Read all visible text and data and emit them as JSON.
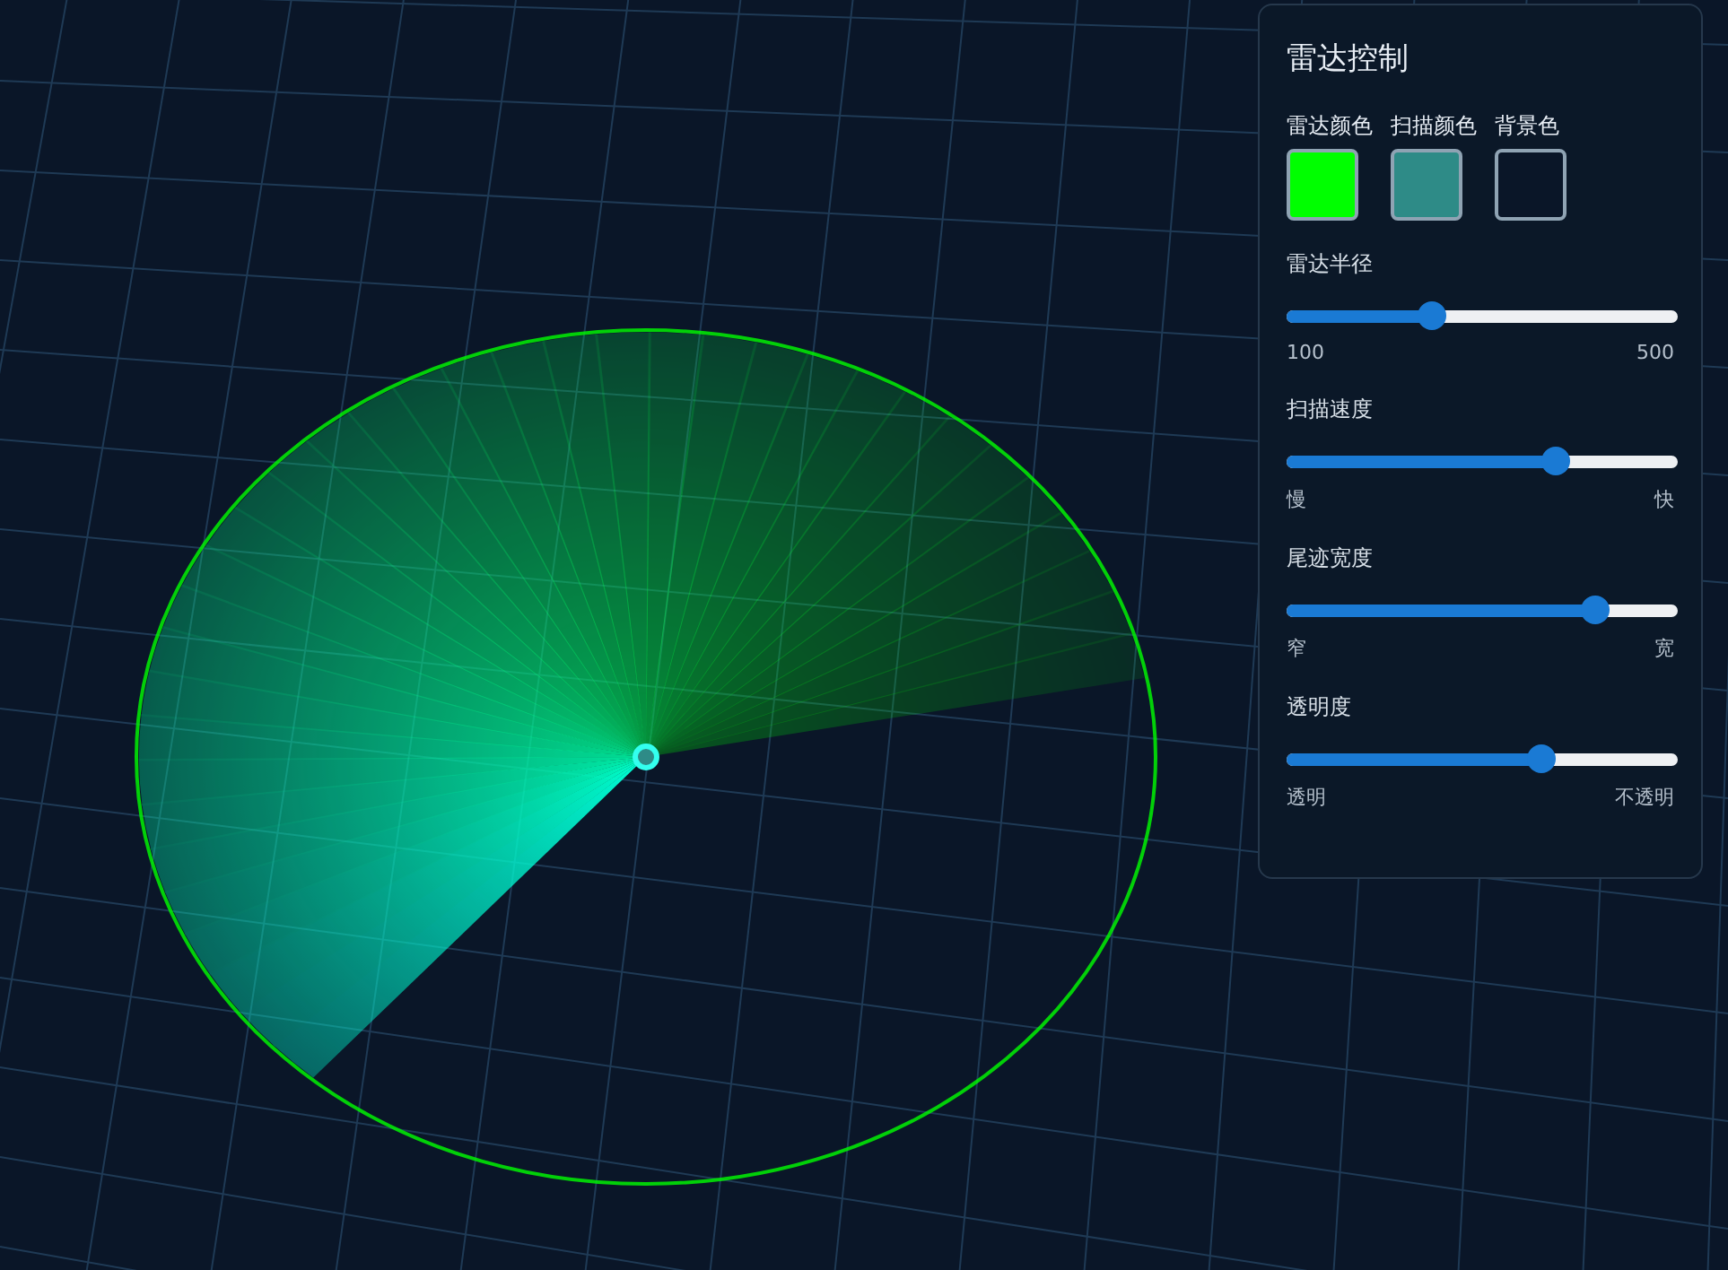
{
  "panel": {
    "title": "雷达控制",
    "colors": [
      {
        "label": "雷达颜色",
        "color": "#00ff00"
      },
      {
        "label": "扫描颜色",
        "color": "#2e8b87"
      },
      {
        "label": "背景色",
        "color": "#0a1628"
      }
    ],
    "sliders": [
      {
        "label": "雷达半径",
        "level": 0.37,
        "min_label": "100",
        "max_label": "500"
      },
      {
        "label": "扫描速度",
        "level": 0.69,
        "min_label": "慢",
        "max_label": "快"
      },
      {
        "label": "尾迹宽度",
        "level": 0.79,
        "min_label": "窄",
        "max_label": "宽"
      },
      {
        "label": "透明度",
        "level": 0.65,
        "min_label": "透明",
        "max_label": "不透明"
      }
    ]
  }
}
